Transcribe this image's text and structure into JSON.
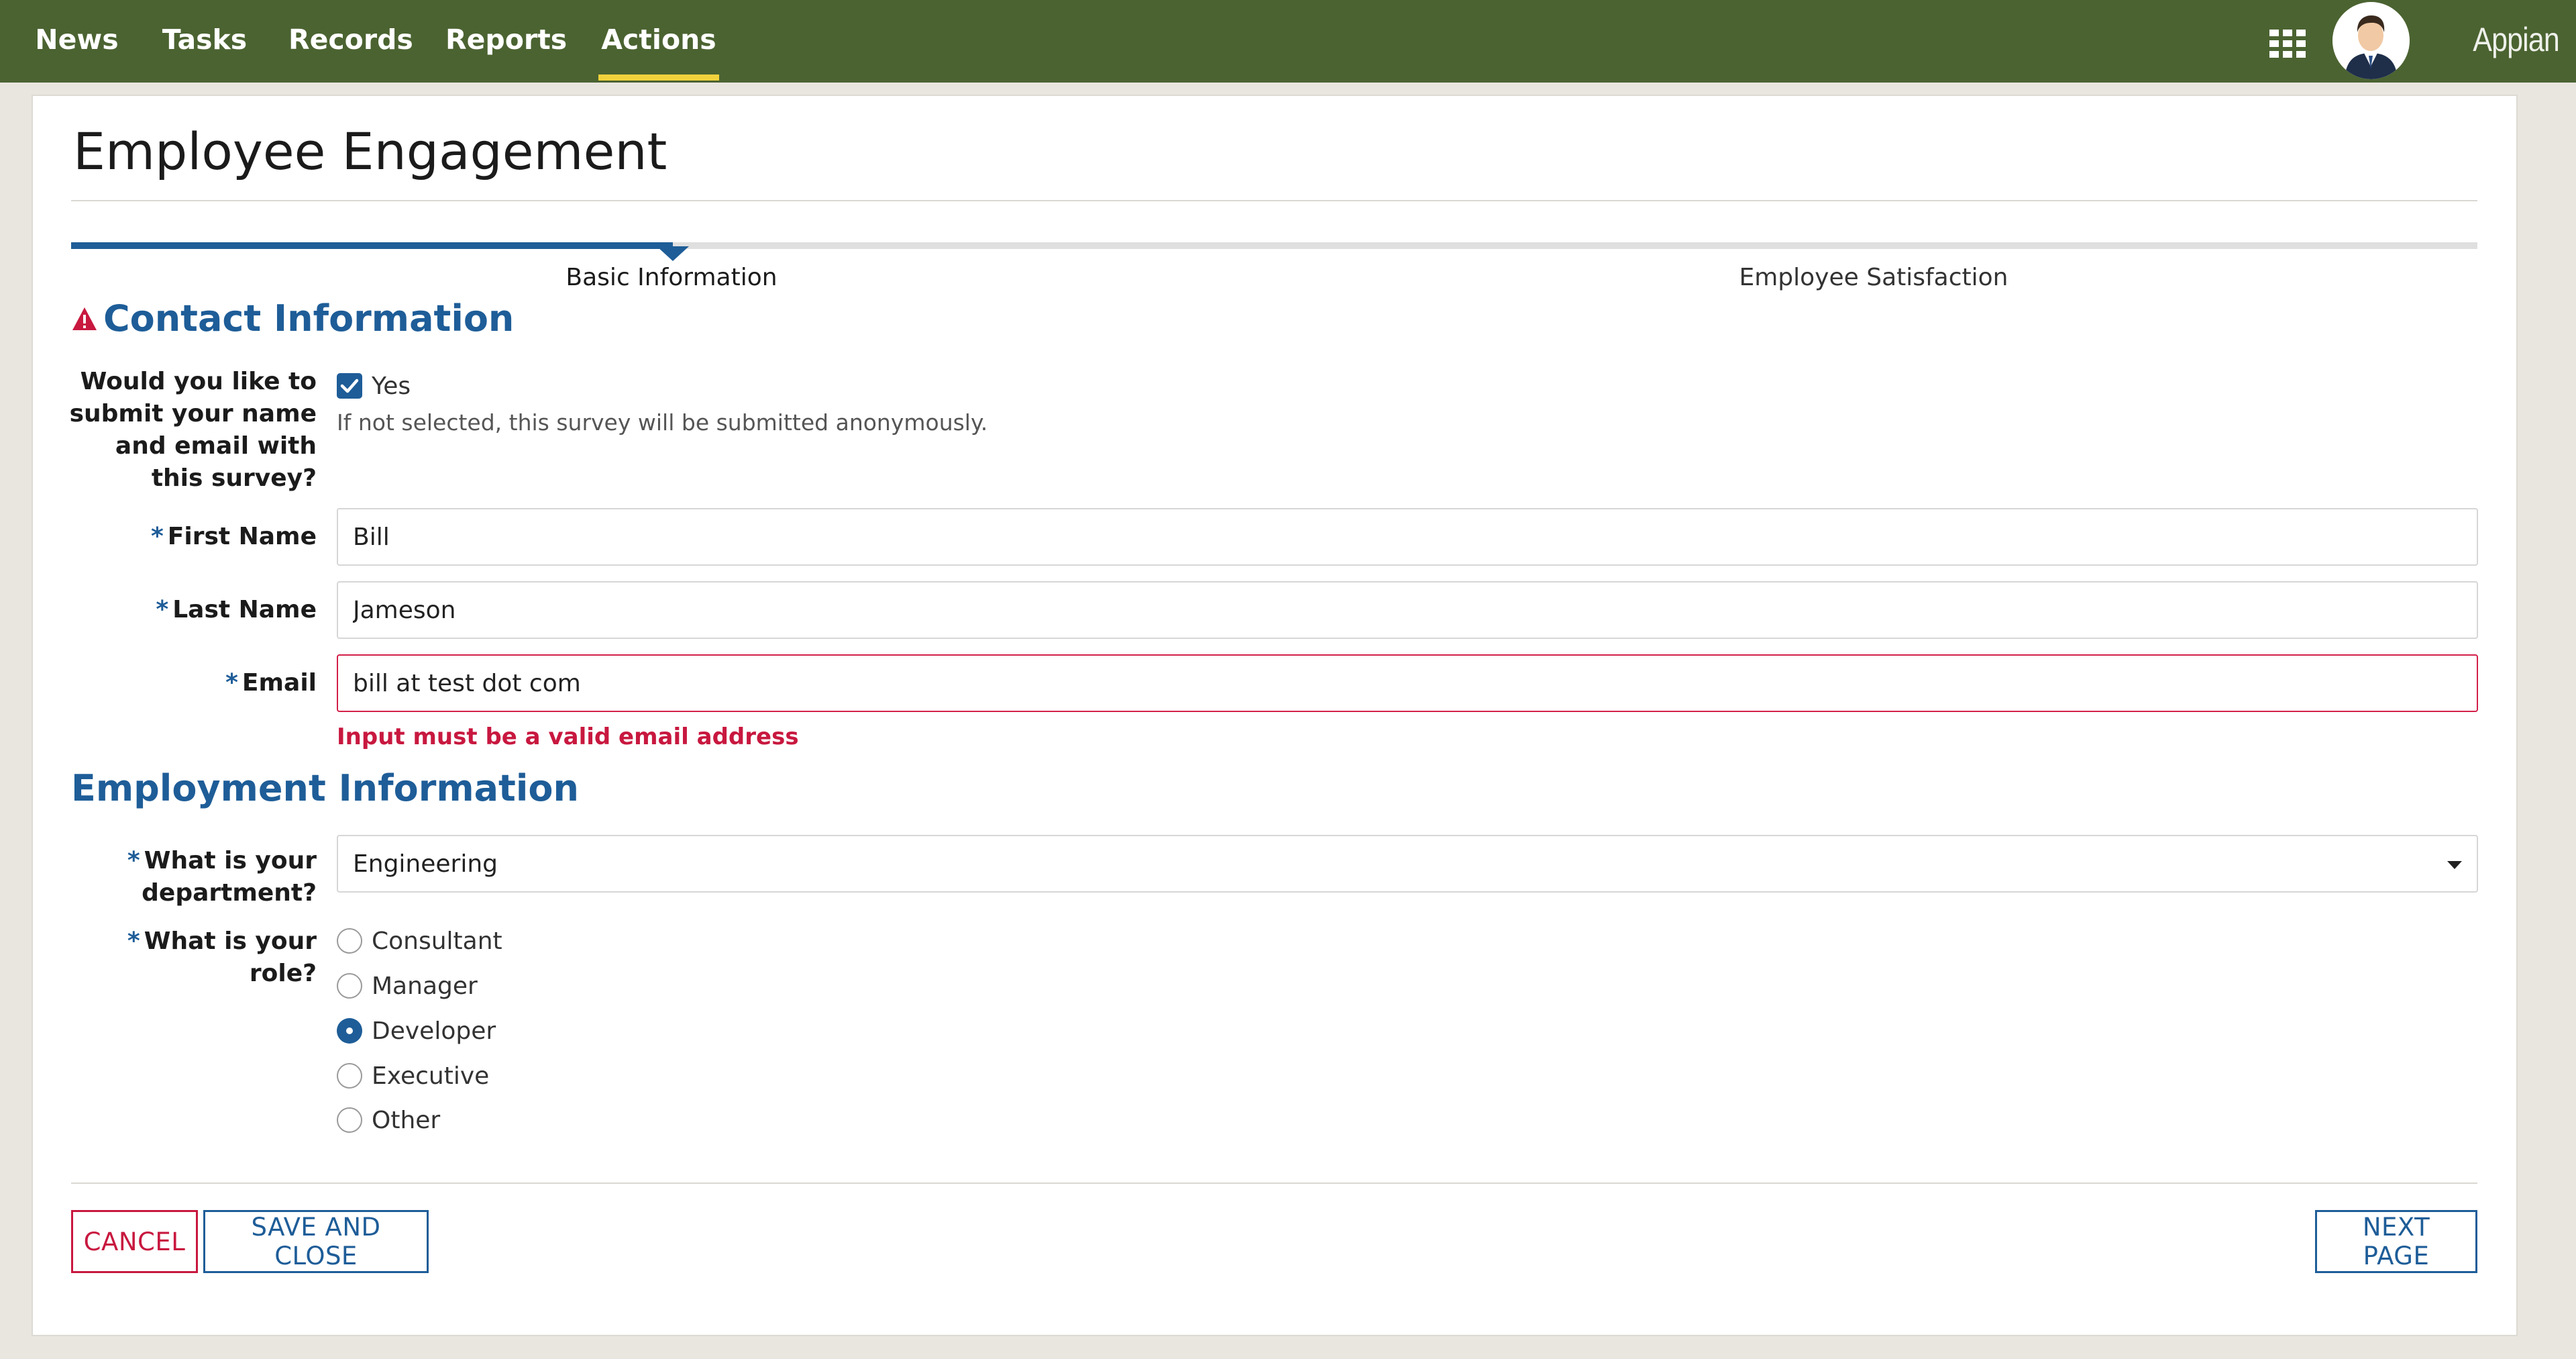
{
  "nav": {
    "items": [
      {
        "label": "News"
      },
      {
        "label": "Tasks"
      },
      {
        "label": "Records"
      },
      {
        "label": "Reports"
      },
      {
        "label": "Actions",
        "active": true
      }
    ],
    "brand": "Appian"
  },
  "page": {
    "title": "Employee Engagement"
  },
  "wizard": {
    "progress_percent": 25,
    "steps": [
      {
        "label": "Basic Information",
        "active": true
      },
      {
        "label": "Employee Satisfaction",
        "active": false
      }
    ]
  },
  "contact": {
    "heading": "Contact Information",
    "has_error": true,
    "submit_identity": {
      "label": "Would you like to submit your name and email with this survey?",
      "option_label": "Yes",
      "checked": true,
      "help_text": "If not selected, this survey will be submitted anonymously."
    },
    "first_name": {
      "label": "First Name",
      "required_marker": "*",
      "value": "Bill"
    },
    "last_name": {
      "label": "Last Name",
      "required_marker": "*",
      "value": "Jameson"
    },
    "email": {
      "label": "Email",
      "required_marker": "*",
      "value": "bill at test dot com",
      "error": "Input must be a valid email address"
    }
  },
  "employment": {
    "heading": "Employment Information",
    "department": {
      "label": "What is your department?",
      "required_marker": "*",
      "selected": "Engineering"
    },
    "role": {
      "label": "What is your role?",
      "required_marker": "*",
      "options": [
        {
          "label": "Consultant",
          "checked": false
        },
        {
          "label": "Manager",
          "checked": false
        },
        {
          "label": "Developer",
          "checked": true
        },
        {
          "label": "Executive",
          "checked": false
        },
        {
          "label": "Other",
          "checked": false
        }
      ]
    }
  },
  "buttons": {
    "cancel": "CANCEL",
    "save_close": "SAVE AND CLOSE",
    "next_page": "NEXT PAGE"
  },
  "colors": {
    "nav_bg": "#4b6331",
    "nav_active_underline": "#f1d23c",
    "accent_blue": "#1e5d98",
    "error_red": "#c8183f",
    "page_bg": "#e9e6df"
  },
  "icons": {
    "apps": "grid-icon",
    "avatar": "user-avatar",
    "warning": "warning-triangle-icon",
    "checkbox": "checkmark-icon",
    "select": "chevron-down-icon"
  }
}
